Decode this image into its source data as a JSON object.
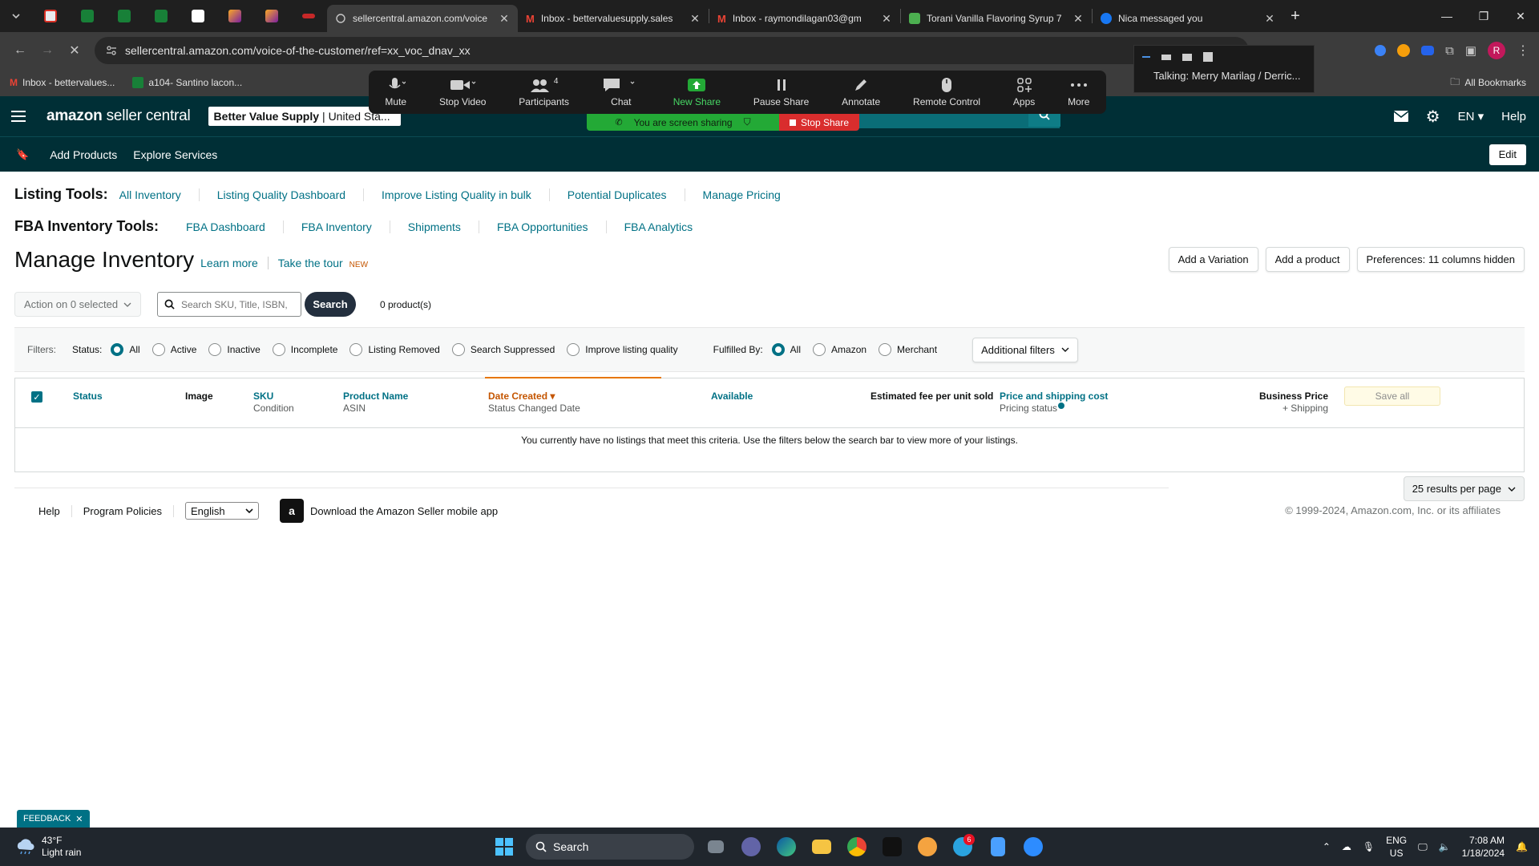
{
  "browser": {
    "tabs": [
      {
        "title": "sellercentral.amazon.com/voice",
        "active": true
      },
      {
        "title": "Inbox - bettervaluesupply.sales",
        "active": false
      },
      {
        "title": "Inbox - raymondilagan03@gm",
        "active": false
      },
      {
        "title": "Torani Vanilla Flavoring Syrup 7",
        "active": false
      },
      {
        "title": "Nica messaged you",
        "active": false
      }
    ],
    "url": "sellercentral.amazon.com/voice-of-the-customer/ref=xx_voc_dnav_xx",
    "bookmarks": [
      "Inbox - bettervalues...",
      "a104- Santino lacon..."
    ],
    "all_bookmarks": "All Bookmarks",
    "profile_initial": "R"
  },
  "zoom": {
    "items": [
      {
        "label": "Mute",
        "icon": "microphone-icon"
      },
      {
        "label": "Stop Video",
        "icon": "video-camera-icon"
      },
      {
        "label": "Participants",
        "icon": "participants-icon",
        "count": "4"
      },
      {
        "label": "Chat",
        "icon": "chat-icon"
      },
      {
        "label": "New Share",
        "icon": "share-screen-icon"
      },
      {
        "label": "Pause Share",
        "icon": "pause-icon"
      },
      {
        "label": "Annotate",
        "icon": "pen-icon"
      },
      {
        "label": "Remote Control",
        "icon": "mouse-icon"
      },
      {
        "label": "Apps",
        "icon": "apps-icon"
      },
      {
        "label": "More",
        "icon": "more-icon"
      }
    ],
    "sharing_text": "You are screen sharing",
    "stop_share": "Stop Share",
    "talking": "Talking: Merry Marilag / Derric..."
  },
  "header": {
    "logo_bold": "amazon",
    "logo_rest": " seller central",
    "store_name": "Better Value Supply",
    "store_region": "United Sta...",
    "language": "EN",
    "help": "Help"
  },
  "subnav": {
    "items": [
      "Add Products",
      "Explore Services"
    ],
    "edit": "Edit"
  },
  "listing_tools": {
    "label": "Listing Tools:",
    "links": [
      "All Inventory",
      "Listing Quality Dashboard",
      "Improve Listing Quality in bulk",
      "Potential Duplicates",
      "Manage Pricing"
    ]
  },
  "fba_tools": {
    "label": "FBA Inventory Tools:",
    "links": [
      "FBA Dashboard",
      "FBA Inventory",
      "Shipments",
      "FBA Opportunities",
      "FBA Analytics"
    ]
  },
  "page": {
    "title": "Manage Inventory",
    "learn_more": "Learn more",
    "take_tour": "Take the tour",
    "new_badge": "NEW",
    "buttons": [
      "Add a Variation",
      "Add a product",
      "Preferences: 11 columns hidden"
    ]
  },
  "actions": {
    "action_select": "Action on 0 selected",
    "search_placeholder": "Search SKU, Title, ISBN,",
    "search_button": "Search",
    "product_count": "0 product(s)"
  },
  "filters": {
    "label": "Filters:",
    "status_label": "Status:",
    "status_options": [
      "All",
      "Active",
      "Inactive",
      "Incomplete",
      "Listing Removed",
      "Search Suppressed",
      "Improve listing quality"
    ],
    "status_selected": 0,
    "fulfilled_label": "Fulfilled By:",
    "fulfilled_options": [
      "All",
      "Amazon",
      "Merchant"
    ],
    "fulfilled_selected": 0,
    "additional": "Additional filters"
  },
  "table": {
    "headers": {
      "status": "Status",
      "image": "Image",
      "sku": "SKU",
      "condition": "Condition",
      "product_name": "Product Name",
      "asin": "ASIN",
      "date_created": "Date Created",
      "status_changed": "Status Changed Date",
      "available": "Available",
      "fee": "Estimated fee per unit sold",
      "price": "Price and shipping cost",
      "pricing_status": "Pricing status",
      "business_price": "Business Price",
      "plus_shipping": "+ Shipping"
    },
    "save_all": "Save all",
    "empty_message": "You currently have no listings that meet this criteria. Use the filters below the search bar to view more of your listings.",
    "per_page": "25 results per page"
  },
  "footer": {
    "links": [
      "Help",
      "Program Policies"
    ],
    "language": "English",
    "app_text": "Download the Amazon Seller mobile app",
    "copyright": "© 1999-2024, Amazon.com, Inc. or its affiliates",
    "feedback": "FEEDBACK"
  },
  "taskbar": {
    "temp": "43°F",
    "weather": "Light rain",
    "search": "Search",
    "lang1": "ENG",
    "lang2": "US",
    "time": "7:08 AM",
    "date": "1/18/2024",
    "telegram_badge": "6"
  },
  "colors": {
    "accent": "#007185",
    "header_bg": "#002f36",
    "sort_orange": "#c45500",
    "share_green": "#23a936",
    "stop_red": "#d92d2d"
  }
}
